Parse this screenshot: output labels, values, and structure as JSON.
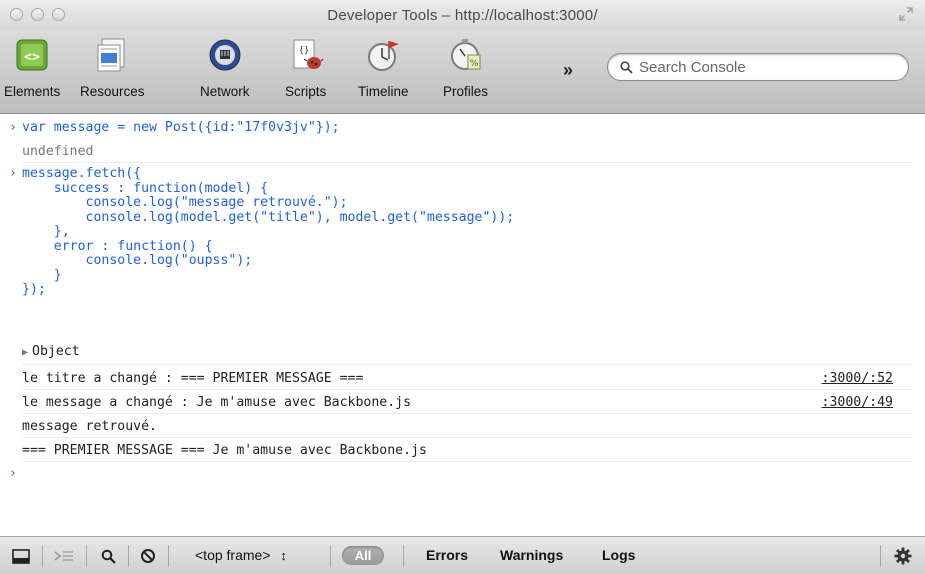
{
  "window": {
    "title": "Developer Tools – http://localhost:3000/"
  },
  "toolbar": {
    "tabs": [
      {
        "label": "Elements",
        "icon": "elements-icon"
      },
      {
        "label": "Resources",
        "icon": "resources-icon"
      },
      {
        "label": "Network",
        "icon": "network-icon"
      },
      {
        "label": "Scripts",
        "icon": "scripts-icon"
      },
      {
        "label": "Timeline",
        "icon": "timeline-icon"
      },
      {
        "label": "Profiles",
        "icon": "profiles-icon"
      }
    ],
    "overflow_label": "»",
    "search_placeholder": "Search Console"
  },
  "console": {
    "prompt": "›",
    "entries": [
      {
        "command": "var message = new Post({id:\"17f0v3jv\"});",
        "result": "undefined"
      },
      {
        "command": "message.fetch({\n    success : function(model) {\n        console.log(\"message retrouvé.\");\n        console.log(model.get(\"title\"), model.get(\"message\"));\n    },\n    error : function() {\n        console.log(\"oupss\");\n    }\n});",
        "result": "Object"
      }
    ],
    "logs": [
      {
        "text": "le titre a changé : === PREMIER MESSAGE ===",
        "source": ":3000/:52"
      },
      {
        "text": "le message a changé : Je m'amuse avec Backbone.js",
        "source": ":3000/:49"
      },
      {
        "text": "message retrouvé.",
        "source": ""
      },
      {
        "text": "=== PREMIER MESSAGE === Je m'amuse avec Backbone.js",
        "source": ""
      }
    ]
  },
  "statusbar": {
    "frame": "<top frame>",
    "frame_arrows": "↕",
    "all_label": "All",
    "filters": [
      "Errors",
      "Warnings",
      "Logs"
    ]
  },
  "colors": {
    "command": "#1f5fe6",
    "prompt": "#2d63c9",
    "result": "#777777"
  }
}
